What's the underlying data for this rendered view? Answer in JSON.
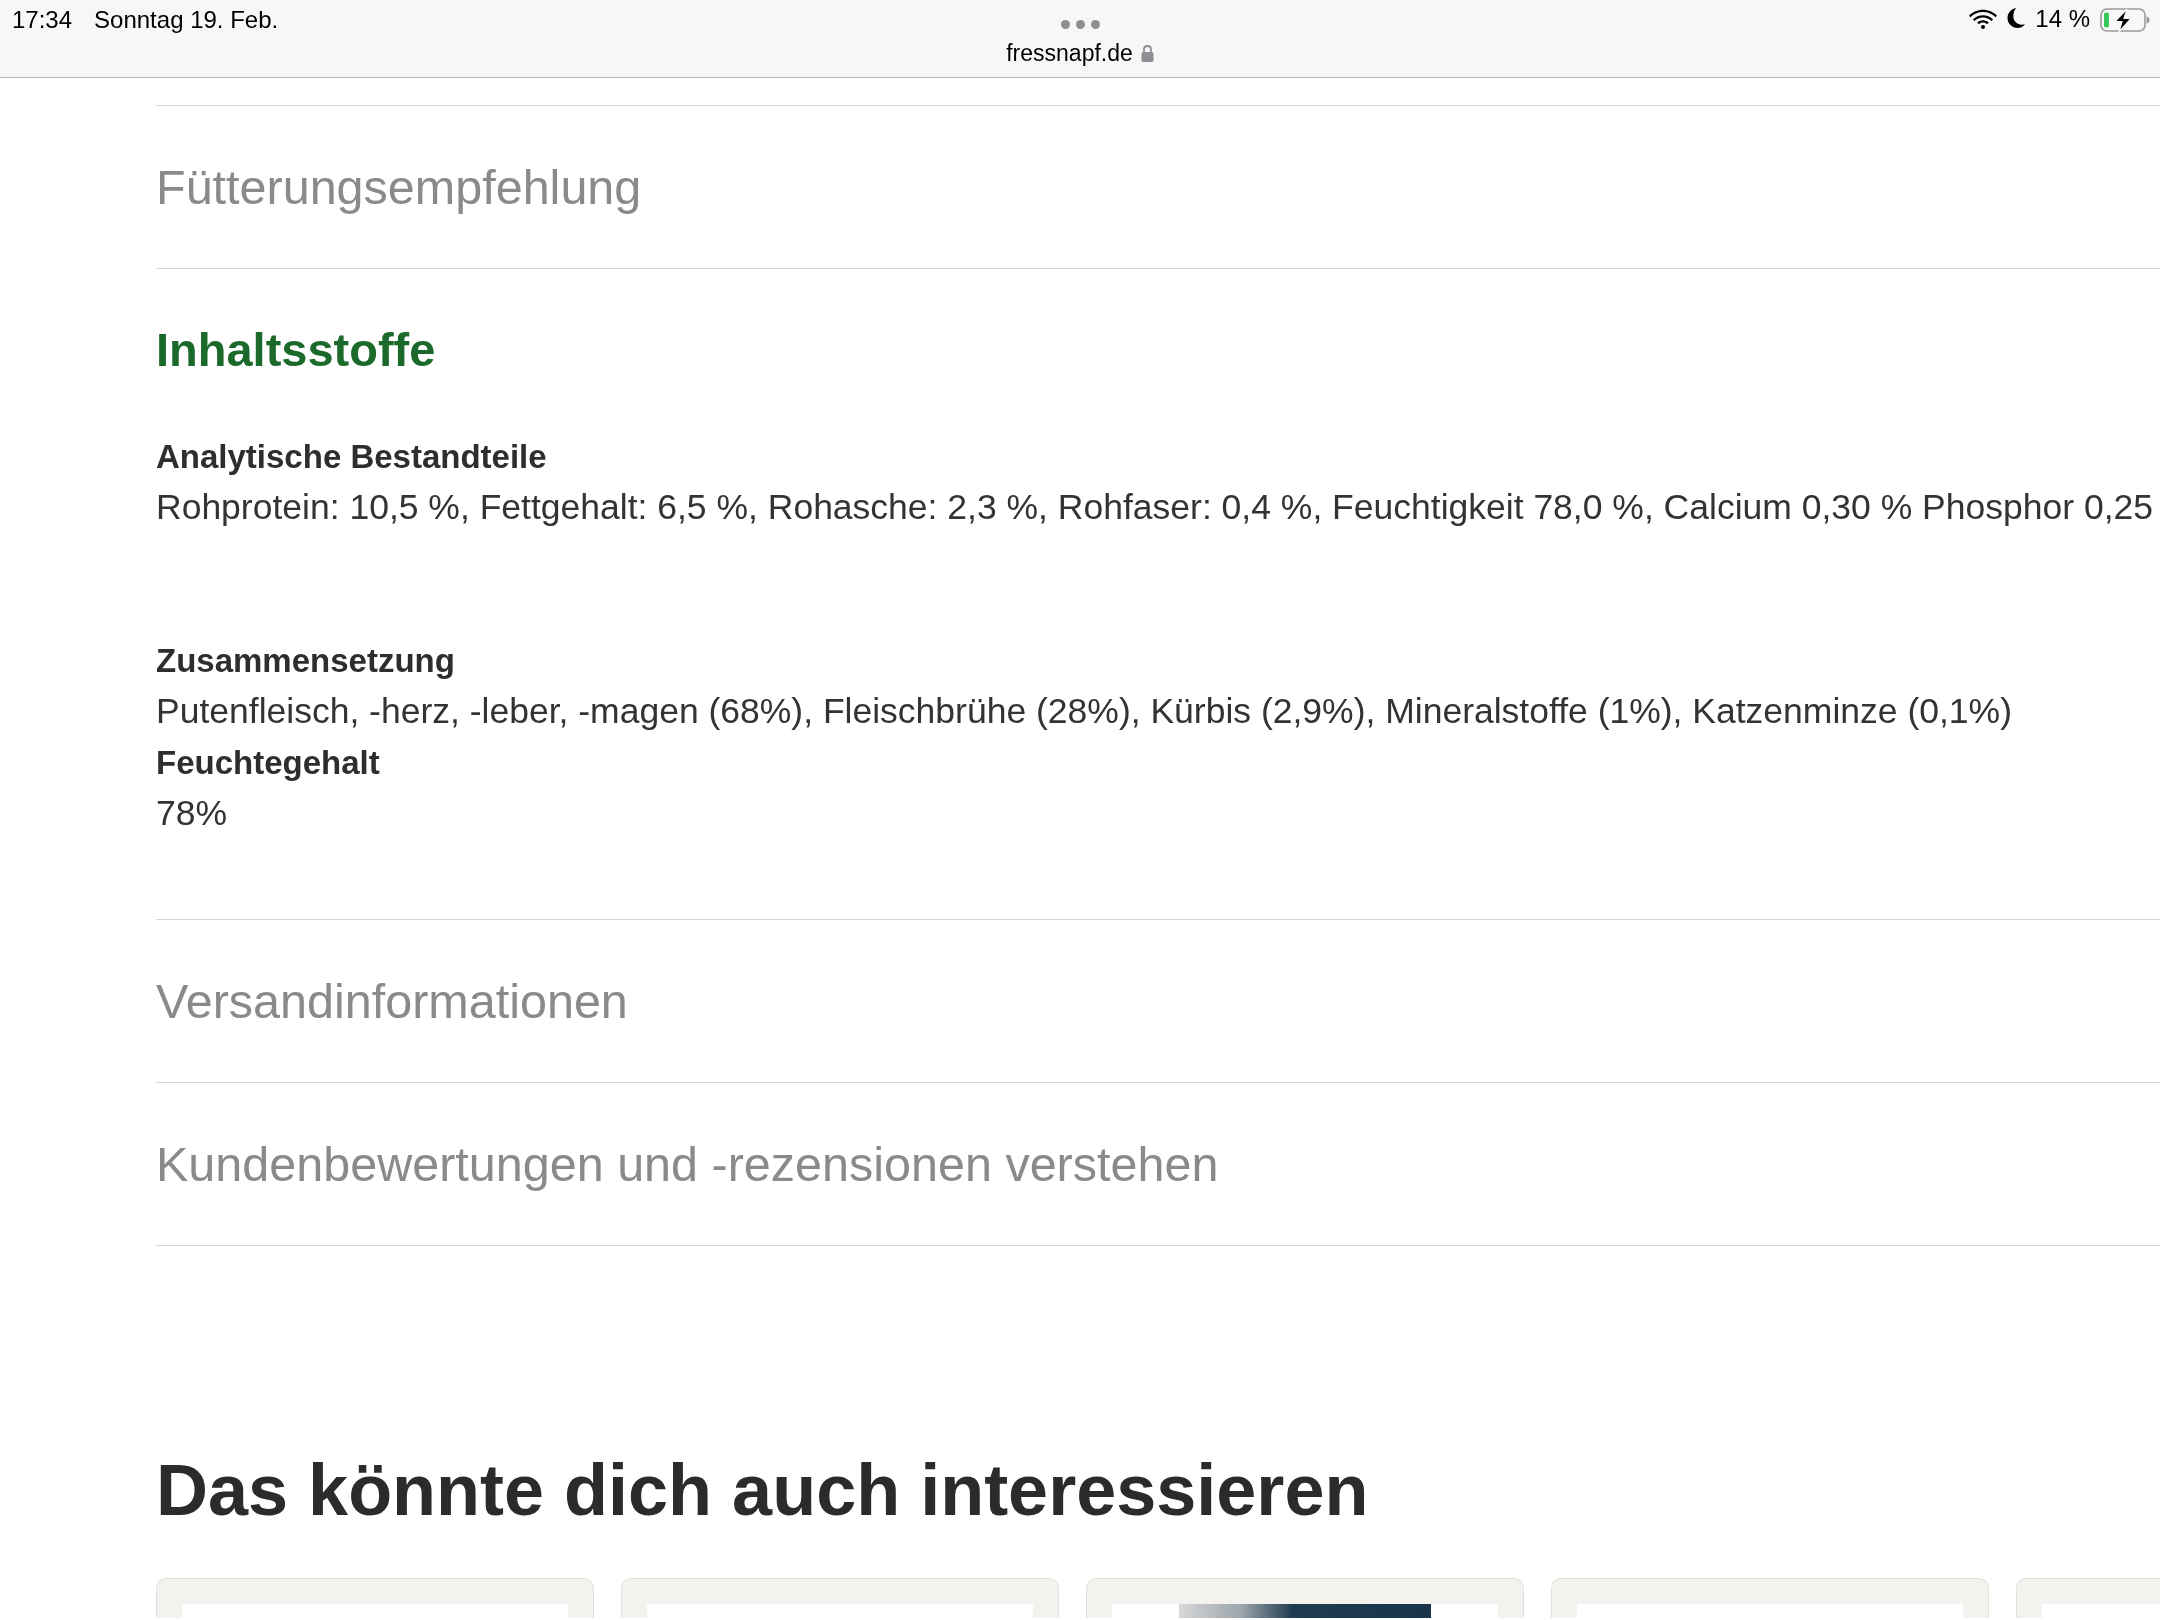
{
  "status_bar": {
    "time": "17:34",
    "date": "Sonntag 19. Feb.",
    "url": "fressnapf.de",
    "battery_text": "14 %"
  },
  "accordion": [
    {
      "title": "Fütterungsempfehlung",
      "expanded": false
    },
    {
      "title": "Inhaltsstoffe",
      "expanded": true,
      "groups": [
        [
          {
            "heading": "Analytische Bestandteile",
            "text": "Rohprotein: 10,5 %, Fettgehalt: 6,5 %, Rohasche: 2,3 %, Rohfaser: 0,4 %, Feuchtigkeit 78,0 %, Calcium 0,30 % Phosphor 0,25"
          }
        ],
        [
          {
            "heading": "Zusammensetzung",
            "text": "Putenfleisch, -herz, -leber, -magen (68%), Fleischbrühe (28%), Kürbis (2,9%), Mineralstoffe (1%), Katzenminze (0,1%)"
          },
          {
            "heading": "Feuchtegehalt",
            "text": "78%"
          }
        ]
      ]
    },
    {
      "title": "Versandinformationen",
      "expanded": false
    },
    {
      "title": "Kundenbewertungen und -rezensionen verstehen",
      "expanded": false
    }
  ],
  "recommendations": {
    "title": "Das könnte dich auch interessieren",
    "cards": [
      {
        "has_image": false
      },
      {
        "has_image": false
      },
      {
        "has_image": true
      },
      {
        "has_image": false
      },
      {
        "has_image": false
      }
    ]
  }
}
